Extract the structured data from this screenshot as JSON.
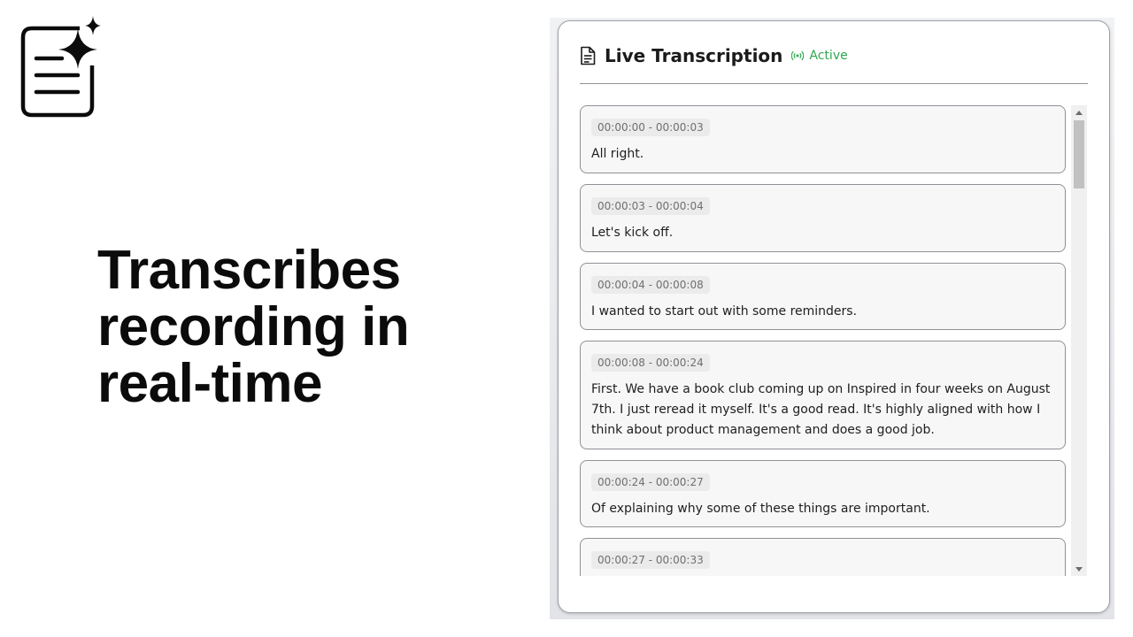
{
  "hero": {
    "line1": "Transcribes",
    "line2": "recording in",
    "line3": "real-time"
  },
  "panel": {
    "title": "Live Transcription",
    "status": "Active",
    "status_color": "#2ea84f"
  },
  "transcript": [
    {
      "time": "00:00:00 - 00:00:03",
      "text": "All right."
    },
    {
      "time": "00:00:03 - 00:00:04",
      "text": "Let's kick off."
    },
    {
      "time": "00:00:04 - 00:00:08",
      "text": "I wanted to start out with some reminders."
    },
    {
      "time": "00:00:08 - 00:00:24",
      "text": "First. We have a book club coming up on Inspired in four weeks on August 7th. I just reread it myself. It's a good read. It's highly aligned with how I think about product management and does a good job."
    },
    {
      "time": "00:00:24 - 00:00:27",
      "text": "Of explaining why some of these things are important."
    },
    {
      "time": "00:00:27 - 00:00:33",
      "text": ""
    }
  ],
  "icons": {
    "logo": "document-sparkle-icon",
    "header": "document-icon",
    "status": "broadcast-icon"
  }
}
